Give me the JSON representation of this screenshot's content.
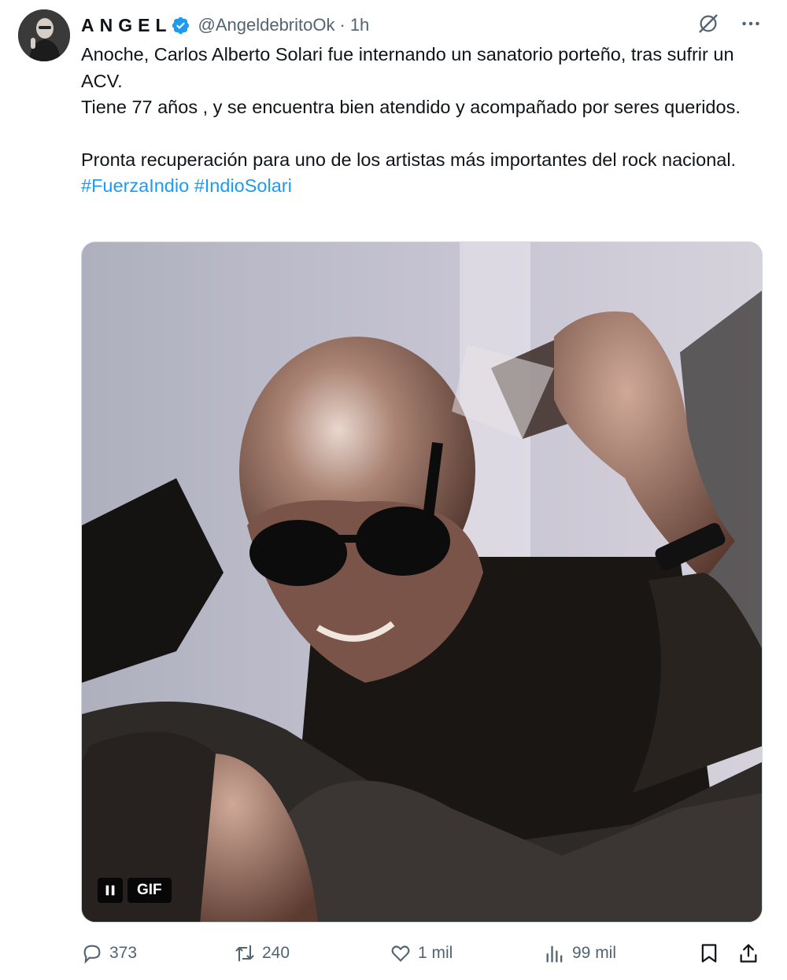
{
  "author": {
    "display_name": "ANGEL",
    "handle": "@AngeldebritoOk",
    "separator": "·",
    "time": "1h",
    "verified": true,
    "verified_color": "#1d9bf0"
  },
  "tweet": {
    "line1": "Anoche, Carlos Alberto Solari fue internando un sanatorio porteño, tras sufrir un ACV.",
    "line2": "Tiene 77 años , y se encuentra bien atendido y acompañado por seres queridos.",
    "line3": "Pronta recuperación para uno de los artistas más importantes del rock nacional.",
    "hashtags": [
      "#FuerzaIndio",
      "#IndioSolari"
    ],
    "hashtag_color": "#1d9bf0"
  },
  "media": {
    "badge": "GIF",
    "pause_icon": "pause-icon"
  },
  "top_icons": [
    "grok-icon",
    "more-icon"
  ],
  "actions": {
    "replies": "373",
    "reposts": "240",
    "likes": "1 mil",
    "views": "99 mil",
    "icons": [
      "reply-icon",
      "repost-icon",
      "like-icon",
      "views-icon",
      "bookmark-icon",
      "share-icon"
    ]
  }
}
